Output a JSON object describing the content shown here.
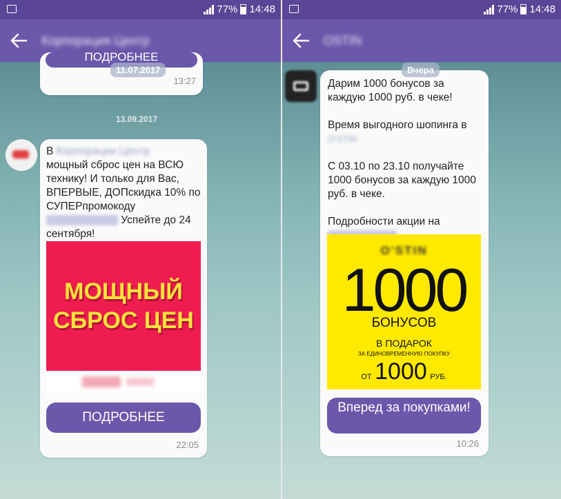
{
  "status_bar": {
    "battery": "77%",
    "time": "14:48"
  },
  "left": {
    "chat_title": "Корпорация Центр",
    "top_button_label": "ПОДРОБНЕЕ",
    "pinned_date": "11.07.2017",
    "prev_time": "13:27",
    "date_separator": "13.09.2017",
    "message": {
      "p1": "В ",
      "sender_blur": "Корпорации Центр",
      "p2": "мощный сброс цен на ВСЮ технику! И только для Вас, ВПЕРВЫЕ, ДОПскидка 10% по СУПЕРпромокоду ",
      "p3": " Успейте до 24 сентября!"
    },
    "banner": {
      "line1": "МОЩНЫЙ",
      "line2": "СБРОС ЦЕН",
      "bg": "#ee1c4f",
      "text_color": "#ffe23a"
    },
    "button_label": "ПОДРОБНЕЕ",
    "time": "22:05"
  },
  "right": {
    "chat_title": "OSTIN",
    "date_pill": "Вчера",
    "message": {
      "l1": "Дарим 1000 бонусов за каждую 1000 руб. в чеке!",
      "l2": "Время выгодного шопинга в",
      "l2_blur": "O'STIN",
      "l3": "С 03.10 по 23.10 получайте 1000 бонусов за каждую 1000 руб. в чеке.",
      "l4": "Подробности акции на"
    },
    "banner": {
      "brand": "O'STIN",
      "big": "1000",
      "bonuses": "БОНУСОВ",
      "gift": "В ПОДАРОК",
      "small": "ЗА ЕДИНОВРЕМЕННУЮ ПОКУПКУ",
      "from": "ОТ",
      "amount": "1000",
      "rub": "РУБ.",
      "bg": "#ffe900"
    },
    "button_label": "Вперед за покупками!",
    "time": "10:26"
  }
}
